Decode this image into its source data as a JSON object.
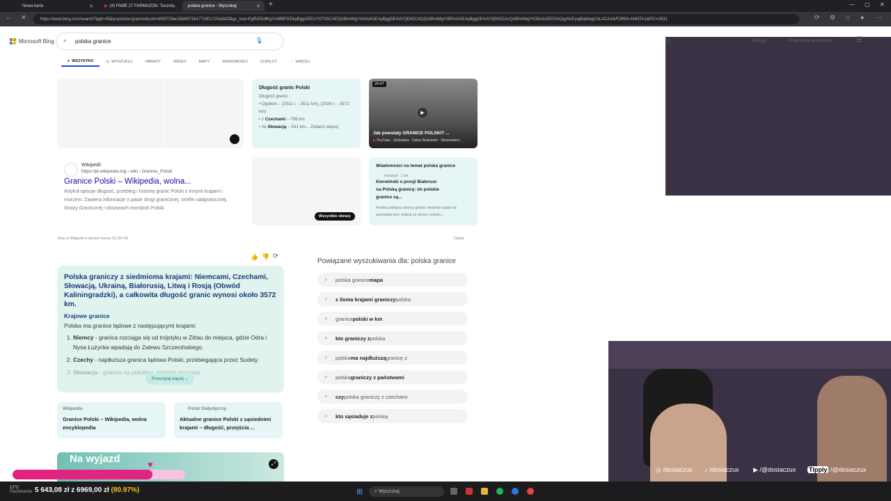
{
  "browser": {
    "tabs": [
      {
        "label": "Nowa karta"
      },
      {
        "label": "(4) FAME 27 FARMAZON: Tuszol..."
      },
      {
        "label": "polska granice - Wyszukaj"
      }
    ],
    "url": "https://www.bing.com/search?pglt=43&q=polska+granice&cvid=bf39728ac28d4573b177c501720a3d2f&gs_lcrp=EgRIZGdlKgYIABBFGDkyBggAEEUYOTIGCAEQABhAMgYIAhAAGEAyBggDEAAYQDIGCAQQABhAMgYIBRAAGEAyBggGEAAYQDIGCAcQABhAMgYICBAAGEDSAQgyNzEyajBqMagCALACAA&FORM=ANNTA1&PC=U531"
  },
  "bing": {
    "logo": "Microsoft Bing",
    "query": "polska granice",
    "login": "Zaloguj",
    "devices": "Urządzenie przenośne",
    "nav": [
      "WSZYSTKO",
      "WYSZUKUJ",
      "OBRAZY",
      "WIDEO",
      "MAPY",
      "WIADOMOŚCI",
      "COPILOT",
      "WIĘCEJ"
    ]
  },
  "facts": {
    "title": "Długość granic Polski",
    "intro": "Długość granic :",
    "line1": "• Ogółem – (2011 r. - 3511 km), (2024 r. - 3572 km)",
    "line2_pre": "• z ",
    "line2_bold": "Czechami",
    "line2_post": " – 796 km",
    "line3_pre": "• ze ",
    "line3_bold": "Słowacją",
    "line3_post": " – 541 km...",
    "more": "Zobacz więcej"
  },
  "video": {
    "duration": "20:47",
    "title": "Jak powstały GRANICE POLSKI? ...",
    "meta": "YouTube · Globalista - Oskar Bednarski · Wyświetleni..."
  },
  "wiki": {
    "site": "Wikipedii",
    "url": "https://pl.wikipedia.org › wiki › Granice_Polski",
    "title": "Granice Polski – Wikipedia, wolna...",
    "snippet": "Artykuł opisuje długość, przebieg i historię granic Polski z innymi krajami i morzem. Zawiera informacje o pasie drogi granicznej, strefie nadgranicznej, Strazy Granicznej i obszarach morskich Polski.",
    "license": "Tekst w Wikipedii w ramach licencji CC-BY-SA",
    "feedback": "Opinia"
  },
  "images": {
    "all": "Wszystkie obrazy"
  },
  "news": {
    "title": "Wiadomości na temat polska granice",
    "source": "Forsal.pl · 1 dni",
    "headline": "Kierwiński o presji Białorusi na Polską granicę: im polskie granice są...",
    "snippet": "Polska polityka obrony granic niestety nadal nie pozostaje bez reakcji ze strony reżimu..."
  },
  "answer": {
    "summary": "Polska graniczy z siedmioma krajami: Niemcami, Czechami, Słowacją, Ukrainą, Białorusią, Litwą i Rosją (Obwód Kaliningradzki), a całkowita długość granic wynosi około 3572 km.",
    "heading": "Krajowe granice",
    "intro": "Polska ma granice lądowe z następującymi krajami:",
    "items": [
      {
        "bold": "Niemcy",
        "text": " - granica rozciąga się od trójstyku w Zittau do miejsca, gdzie Odra i Nysa Łużycka wpadają do Zalewu Szczecińskiego."
      },
      {
        "bold": "Czechy",
        "text": " - najdłuższa granica lądowa Polski, przebiegająca przez Sudety."
      },
      {
        "bold": "Słowacja",
        "text": " - granica na południu, również górzysta."
      }
    ],
    "more": "Przeczytaj więcej"
  },
  "sources": [
    {
      "site": "Wikipedia",
      "title": "Granice Polski – Wikipedia, wolna encyklopedia"
    },
    {
      "site": "Portal Statystyczny",
      "title": "Aktualne granice Polski z sąsiednimi krajami – długość, przejścia ..."
    }
  ],
  "related": {
    "title": "Powiązane wyszukiwania dla: polska granice",
    "items": [
      {
        "pre": "polska granice ",
        "bold": "mapa",
        "post": ""
      },
      {
        "pre": "",
        "bold": "z iloma krajami graniczy",
        "post": " polska"
      },
      {
        "pre": "granice ",
        "bold": "polski w km",
        "post": ""
      },
      {
        "pre": "",
        "bold": "kto graniczy z",
        "post": " polska"
      },
      {
        "pre": "polska ",
        "bold": "ma najdłuższą",
        "post": " granicę z"
      },
      {
        "pre": "polska ",
        "bold": "graniczy z państwami",
        "post": ""
      },
      {
        "pre": "",
        "bold": "czy",
        "post": " polska graniczy z czechami"
      },
      {
        "pre": "",
        "bold": "kto sąsiaduje z",
        "post": " polską"
      }
    ]
  },
  "overlay": {
    "goal_title": "Na wyjazd",
    "goal_amount": "5 643,08 zł z 6969,00 zł",
    "goal_percent": "(80.97%)",
    "goal_fraction": 0.8097,
    "socials": [
      "/dosiaczux",
      "/dosiaczux",
      "/@dosiaczux",
      "/@dosiaczux"
    ],
    "tippy": "Tipply",
    "weather_temp": "12°C",
    "weather_desc": "Pochmurnie"
  },
  "taskbar": {
    "search": "Wyszukaj"
  }
}
